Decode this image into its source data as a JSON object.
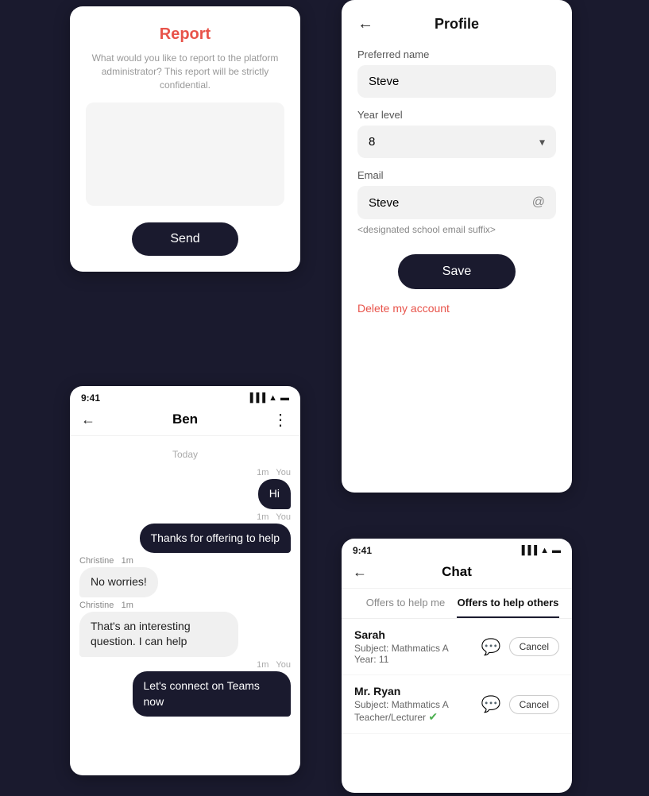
{
  "report": {
    "title": "Report",
    "subtitle": "What would you like to report to the platform administrator? This report will be strictly confidential.",
    "send_label": "Send",
    "textarea_placeholder": ""
  },
  "profile": {
    "title": "Profile",
    "back_icon": "←",
    "preferred_name_label": "Preferred name",
    "preferred_name_value": "Steve",
    "year_level_label": "Year level",
    "year_level_value": "8",
    "email_label": "Email",
    "email_value": "Steve",
    "email_suffix": "<designated school email suffix>",
    "save_label": "Save",
    "delete_label": "Delete my account"
  },
  "chat_ben": {
    "status_time": "9:41",
    "back_icon": "←",
    "title": "Ben",
    "more_icon": "⋮",
    "date_divider": "Today",
    "messages": [
      {
        "side": "sent",
        "time": "1m",
        "sender": "You",
        "text": "Hi"
      },
      {
        "side": "sent",
        "time": "1m",
        "sender": "You",
        "text": "Thanks for offering to help"
      },
      {
        "side": "received",
        "sender": "Christine",
        "time": "1m",
        "text": "No worries!"
      },
      {
        "side": "received",
        "sender": "Christine",
        "time": "1m",
        "text": "That's an interesting question. I can help"
      },
      {
        "side": "sent",
        "time": "1m",
        "sender": "You",
        "text": "Let's connect on Teams now"
      }
    ]
  },
  "chat_offers": {
    "status_time": "9:41",
    "back_icon": "←",
    "title": "Chat",
    "tabs": [
      {
        "label": "Offers to help me",
        "active": false
      },
      {
        "label": "Offers to help others",
        "active": true
      }
    ],
    "offers": [
      {
        "name": "Sarah",
        "subject": "Subject: Mathmatics A",
        "year": "Year: 11",
        "verified": false,
        "cancel_label": "Cancel"
      },
      {
        "name": "Mr. Ryan",
        "subject": "Subject: Mathmatics A",
        "year": "Teacher/Lecturer",
        "verified": true,
        "cancel_label": "Cancel"
      }
    ]
  }
}
